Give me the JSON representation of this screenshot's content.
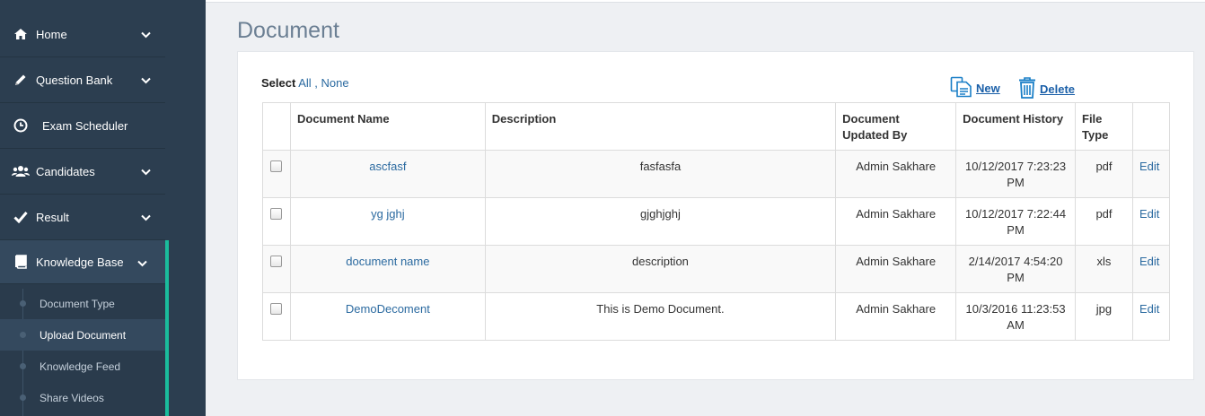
{
  "sidebar": {
    "items": [
      {
        "label": "Home",
        "icon": "home-icon"
      },
      {
        "label": "Question Bank",
        "icon": "pencil-icon"
      },
      {
        "label": "Exam Scheduler",
        "icon": "clock-icon"
      },
      {
        "label": "Candidates",
        "icon": "users-icon"
      },
      {
        "label": "Result",
        "icon": "check-icon"
      },
      {
        "label": "Knowledge Base",
        "icon": "book-icon"
      }
    ],
    "sub_items": [
      {
        "label": "Document Type"
      },
      {
        "label": "Upload Document"
      },
      {
        "label": "Knowledge Feed"
      },
      {
        "label": "Share Videos"
      }
    ],
    "active_color": "#1abc9c"
  },
  "page": {
    "title": "Document"
  },
  "select": {
    "label": "Select",
    "all": "All",
    "separator": ",",
    "none": "None"
  },
  "actions": {
    "new": "New",
    "delete": "Delete"
  },
  "table": {
    "headers": {
      "name": "Document Name",
      "description": "Description",
      "updated_by": "Document Updated By",
      "history": "Document History",
      "file_type": "File Type"
    },
    "rows": [
      {
        "name": "ascfasf",
        "description": "fasfasfa",
        "updated_by": "Admin Sakhare",
        "history": "10/12/2017 7:23:23 PM",
        "file_type": "pdf",
        "edit": "Edit"
      },
      {
        "name": "yg jghj",
        "description": "gjghjghj",
        "updated_by": "Admin Sakhare",
        "history": "10/12/2017 7:22:44 PM",
        "file_type": "pdf",
        "edit": "Edit"
      },
      {
        "name": "document name",
        "description": "description",
        "updated_by": "Admin Sakhare",
        "history": "2/14/2017 4:54:20 PM",
        "file_type": "xls",
        "edit": "Edit"
      },
      {
        "name": "DemoDecoment",
        "description": "This is Demo Document.",
        "updated_by": "Admin Sakhare",
        "history": "10/3/2016 11:23:53 AM",
        "file_type": "jpg",
        "edit": "Edit"
      }
    ]
  }
}
